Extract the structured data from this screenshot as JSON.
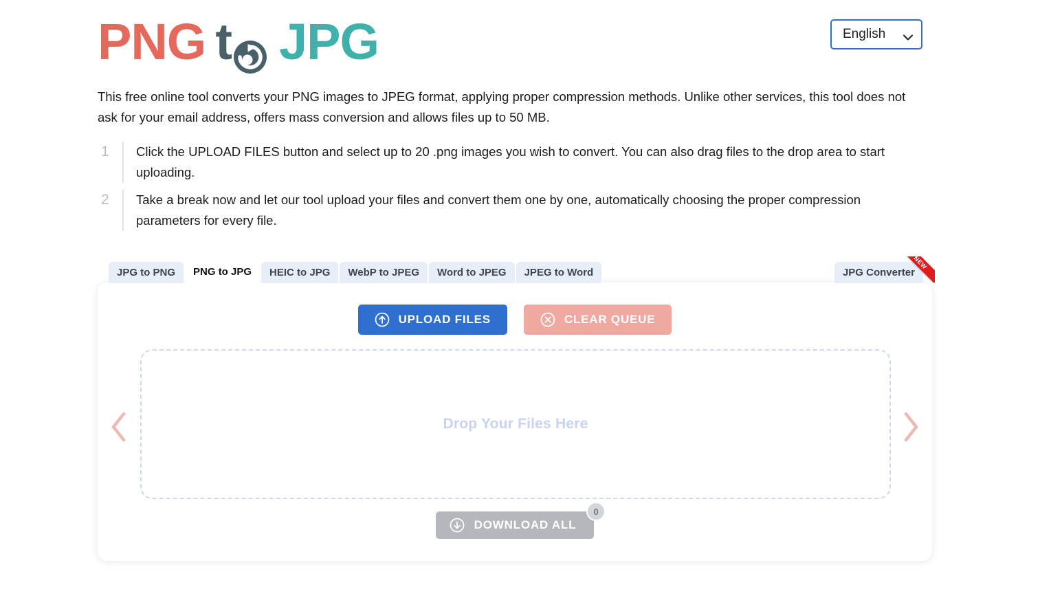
{
  "header": {
    "logo": {
      "part1": "PNG",
      "part2": "t",
      "icon": "convert-circular-arrow-icon",
      "part3": "JPG"
    },
    "language": {
      "selected": "English",
      "icon": "chevron-down-icon"
    }
  },
  "description": "This free online tool converts your PNG images to JPEG format, applying proper compression methods. Unlike other services, this tool does not ask for your email address, offers mass conversion and allows files up to 50 MB.",
  "steps": [
    {
      "number": "1",
      "text": "Click the UPLOAD FILES button and select up to 20 .png images you wish to convert. You can also drag files to the drop area to start uploading."
    },
    {
      "number": "2",
      "text": "Take a break now and let our tool upload your files and convert them one by one, automatically choosing the proper compression parameters for every file."
    }
  ],
  "tabs": {
    "items": [
      {
        "label": "JPG to PNG",
        "active": false
      },
      {
        "label": "PNG to JPG",
        "active": true
      },
      {
        "label": "HEIC to JPG",
        "active": false
      },
      {
        "label": "WebP to JPEG",
        "active": false
      },
      {
        "label": "Word to JPEG",
        "active": false
      },
      {
        "label": "JPEG to Word",
        "active": false
      }
    ],
    "right_tab": {
      "label": "JPG Converter",
      "badge": "NEW"
    }
  },
  "card": {
    "upload_button": {
      "label": "UPLOAD FILES",
      "icon": "upload-arrow-circle-icon"
    },
    "clear_button": {
      "label": "CLEAR QUEUE",
      "icon": "close-circle-icon"
    },
    "dropzone": {
      "text": "Drop Your Files Here"
    },
    "carousel": {
      "prev_icon": "chevron-left-icon",
      "next_icon": "chevron-right-icon"
    },
    "download_button": {
      "label": "DOWNLOAD ALL",
      "icon": "download-arrow-circle-icon",
      "count": "0"
    }
  },
  "colors": {
    "png_red": "#e4695c",
    "jpg_teal": "#40b0ab",
    "to_slate": "#4a6069",
    "upload_blue": "#2f6fd0",
    "clear_salmon": "#f0a9a0",
    "download_gray": "#b4b8bd",
    "ribbon_red": "#e01b1b",
    "dropzone_border": "#ccd9ef",
    "dropzone_text": "#c9d3ef",
    "tab_inactive": "#e8eef8"
  }
}
